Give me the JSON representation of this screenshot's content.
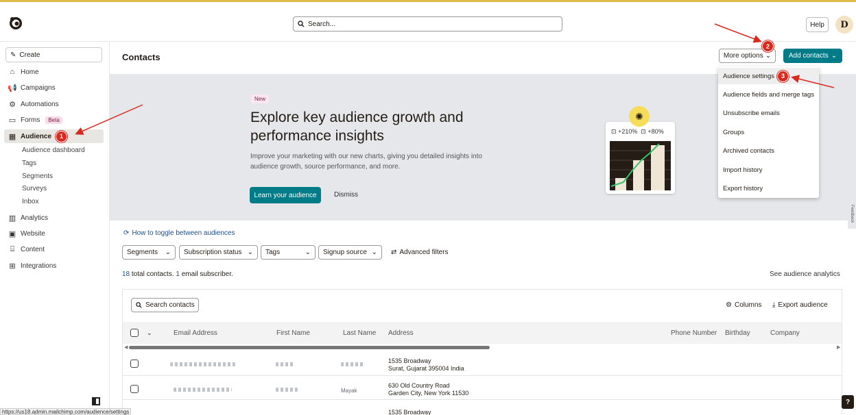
{
  "app": {
    "search_placeholder": "Search...",
    "help_label": "Help",
    "avatar_initial": "D",
    "status_url": "https://us18.admin.mailchimp.com/audience/settings"
  },
  "sidebar": {
    "create_label": "Create",
    "items": [
      {
        "label": "Home",
        "icon": "home-icon"
      },
      {
        "label": "Campaigns",
        "icon": "megaphone-icon"
      },
      {
        "label": "Automations",
        "icon": "automation-icon"
      },
      {
        "label": "Forms",
        "icon": "form-icon",
        "badge": "Beta"
      },
      {
        "label": "Audience",
        "icon": "audience-icon"
      },
      {
        "label": "Analytics",
        "icon": "bar-chart-icon"
      },
      {
        "label": "Website",
        "icon": "website-icon"
      },
      {
        "label": "Content",
        "icon": "content-icon"
      },
      {
        "label": "Integrations",
        "icon": "grid-icon"
      }
    ],
    "audience_sub": [
      "Audience dashboard",
      "Tags",
      "Segments",
      "Surveys",
      "Inbox"
    ]
  },
  "header": {
    "title": "Contacts",
    "more_options": "More options",
    "add_contacts": "Add contacts"
  },
  "dropdown": {
    "items": [
      "Audience settings",
      "Audience fields and merge tags",
      "Unsubscribe emails",
      "Groups",
      "Archived contacts",
      "Import history",
      "Export history"
    ]
  },
  "banner": {
    "pill": "New",
    "title": "Explore key audience growth and performance insights",
    "description": "Improve your marketing with our new charts, giving you detailed insights into audience growth, source performance, and more.",
    "learn_button": "Learn your audience",
    "dismiss": "Dismiss",
    "stat1": "+210%",
    "stat2": "+80%"
  },
  "filters": {
    "toggle_link": "How to toggle between audiences",
    "segments": "Segments",
    "subscription_status": "Subscription status",
    "tags": "Tags",
    "signup_source": "Signup source",
    "advanced": "Advanced filters"
  },
  "summary": {
    "total_count": "18",
    "total_text": " total contacts. ",
    "subscriber_count": "1",
    "subscriber_text": " email subscriber.",
    "see_analytics": "See audience analytics"
  },
  "table": {
    "search_label": "Search contacts",
    "columns_label": "Columns",
    "export_label": "Export audience",
    "headers": [
      "Email Address",
      "First Name",
      "Last Name",
      "Address",
      "Phone Number",
      "Birthday",
      "Company"
    ],
    "rows": [
      {
        "address_line1": "1535 Broadway",
        "address_line2": "Surat, Gujarat 395004 India",
        "last_name_visible": ""
      },
      {
        "address_line1": "630 Old Country Road",
        "address_line2": "Garden City, New York 11530",
        "last_name_visible": "Mayak"
      },
      {
        "address_line1": "1535 Broadway",
        "address_line2": "",
        "last_name_visible": ""
      }
    ]
  },
  "annotations": {
    "badges": [
      "1",
      "2",
      "3"
    ],
    "color": "#d9281e"
  },
  "misc": {
    "feedback": "Feedback",
    "help_q": "?"
  }
}
